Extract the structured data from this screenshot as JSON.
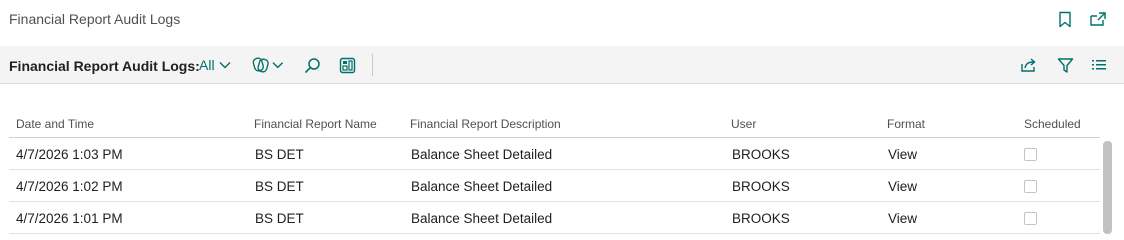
{
  "title": "Financial Report Audit Logs",
  "actionbar": {
    "caption": "Financial Report Audit Logs:",
    "filter_value": "All"
  },
  "icons": {
    "bookmark": "bookmark-icon",
    "open_new": "open-in-new-window-icon",
    "analysis": "analysis-mode-icon",
    "search": "search-icon",
    "layout": "layout-icon",
    "share": "share-icon",
    "filter": "filter-icon",
    "list": "list-view-icon"
  },
  "accent_color": "#00706b",
  "table": {
    "columns": [
      "Date and Time",
      "Financial Report Name",
      "Financial Report Description",
      "User",
      "Format",
      "Scheduled"
    ],
    "rows": [
      {
        "datetime": "4/7/2026 1:03 PM",
        "name": "BS DET",
        "description": "Balance Sheet Detailed",
        "user": "BROOKS",
        "format": "View",
        "scheduled": false
      },
      {
        "datetime": "4/7/2026 1:02 PM",
        "name": "BS DET",
        "description": "Balance Sheet Detailed",
        "user": "BROOKS",
        "format": "View",
        "scheduled": false
      },
      {
        "datetime": "4/7/2026 1:01 PM",
        "name": "BS DET",
        "description": "Balance Sheet Detailed",
        "user": "BROOKS",
        "format": "View",
        "scheduled": false
      }
    ]
  }
}
